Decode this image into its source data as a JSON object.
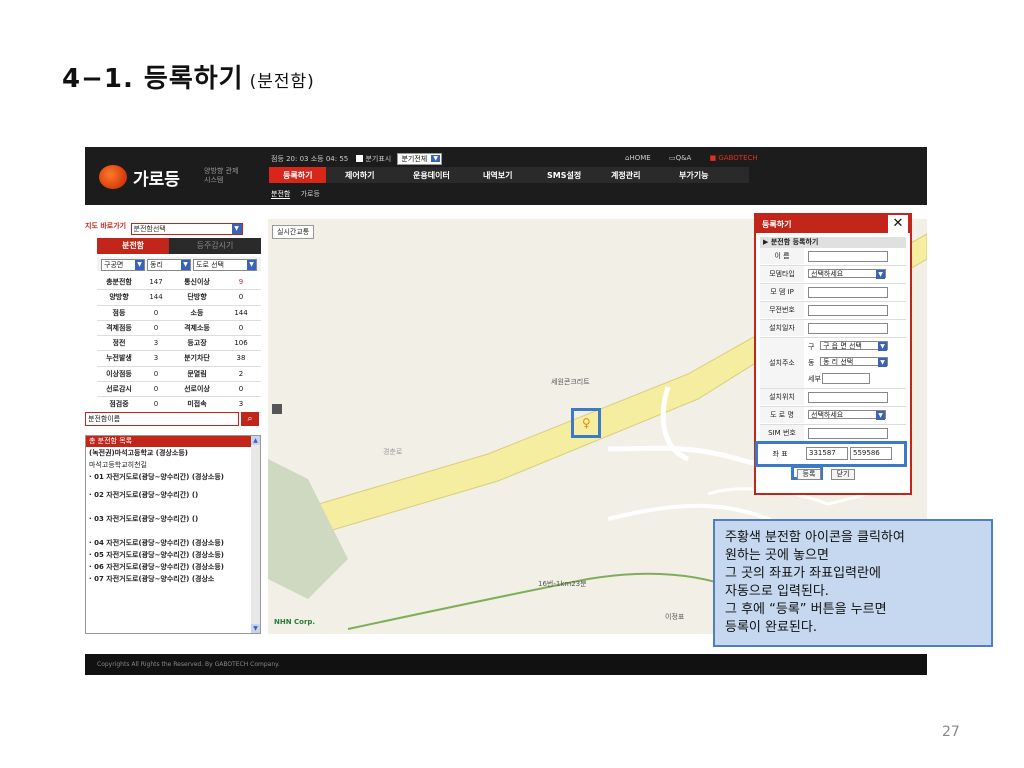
{
  "slide": {
    "title": "4−1. 등록하기",
    "subtitle": "(분전함)",
    "page_number": "27"
  },
  "header": {
    "logo_name": "가로등",
    "logo_tagline": "양방향 관제시스템",
    "stats": "점등 20: 03 소등 04: 55",
    "chk_label": "분기표시",
    "branch_select": "분기전체",
    "top_links": [
      "HOME",
      "Q&A",
      "GABOTECH"
    ],
    "menu": [
      "등록하기",
      "제어하기",
      "운용데이터",
      "내역보기",
      "SMS설정",
      "계정관리",
      "부가기능"
    ],
    "submenu": [
      "분전함",
      "가로등"
    ]
  },
  "left": {
    "jump_label": "지도 바로가기",
    "jump_select": "분전함선택",
    "tabs": [
      "분전함",
      "등주감시기"
    ],
    "filters": [
      "구공면",
      "동리",
      "도로 선택"
    ],
    "stats_rows": [
      {
        "l": "총분전함",
        "v": "147",
        "l2": "통신이상",
        "v2": "9"
      },
      {
        "l": "양방향",
        "v": "144",
        "l2": "단방향",
        "v2": "0"
      },
      {
        "l": "점등",
        "v": "0",
        "l2": "소등",
        "v2": "144"
      },
      {
        "l": "격제점등",
        "v": "0",
        "l2": "격제소등",
        "v2": "0"
      },
      {
        "l": "정전",
        "v": "3",
        "l2": "등고장",
        "v2": "106"
      },
      {
        "l": "누전발생",
        "v": "3",
        "l2": "분기차단",
        "v2": "38"
      },
      {
        "l": "이상점등",
        "v": "0",
        "l2": "문열림",
        "v2": "2"
      },
      {
        "l": "선로감시",
        "v": "0",
        "l2": "선로이상",
        "v2": "0"
      },
      {
        "l": "점검중",
        "v": "0",
        "l2": "미접속",
        "v2": "3"
      }
    ],
    "search_select": "분전함이름",
    "list_title": "총 분전함 목록",
    "list": [
      {
        "t": "(녹전권)마석고등학교 (경상소등)",
        "b": true
      },
      {
        "t": "마석고등학교히천길",
        "b": false
      },
      {
        "t": "· 01 자전거도로(광당~양수리간) (경상소등)",
        "b": true
      },
      {
        "t": "· 02 자전거도로(광당~양수리간) ()",
        "b": true
      },
      {
        "t": "· 03 자전거도로(광당~양수리간) ()",
        "b": true
      },
      {
        "t": "· 04 자전거도로(광당~양수리간) (경상소등)",
        "b": true
      },
      {
        "t": "· 05 자전거도로(광당~양수리간) (경상소등)",
        "b": true
      },
      {
        "t": "· 06 자전거도로(광당~양수리간) (경상소등)",
        "b": true
      },
      {
        "t": "· 07 자전거도로(광당~양수리간) (경상소",
        "b": true
      }
    ]
  },
  "map": {
    "button": "실시간교통",
    "labels": [
      "세원콘크리트",
      "경춘로",
      "이정표",
      "16번-1km23분"
    ],
    "credit": "NHN Corp."
  },
  "popup": {
    "title": "등록하기",
    "section": "분전함 등록하기",
    "fields": [
      {
        "label": "이  름",
        "type": "input",
        "value": ""
      },
      {
        "label": "모뎀타입",
        "type": "select",
        "value": "선택하세요"
      },
      {
        "label": "모 뎀 IP",
        "type": "input",
        "value": ""
      },
      {
        "label": "무전번호",
        "type": "input",
        "value": ""
      },
      {
        "label": "설치일자",
        "type": "input",
        "value": ""
      }
    ],
    "address_label": "설치주소",
    "address": [
      {
        "k": "구",
        "v": "구 읍 면 선택"
      },
      {
        "k": "동",
        "v": "동 리 선택"
      },
      {
        "k": "세부",
        "v": ""
      }
    ],
    "fields2": [
      {
        "label": "설치위치",
        "type": "input",
        "value": ""
      },
      {
        "label": "도 로 명",
        "type": "select",
        "value": "선택하세요"
      },
      {
        "label": "SIM 번호",
        "type": "input",
        "value": ""
      }
    ],
    "coord_label": "좌  표",
    "coord_x": "331587",
    "coord_y": "559586",
    "register_btn": "등록",
    "close_btn": "닫기"
  },
  "footer": "Copyrights All Rights the Reserved. By GABOTECH Company.",
  "callout": [
    "주황색 분전함 아이콘을 클릭하여",
    "원하는 곳에  놓으면",
    "그 곳의 좌표가  좌표입력란에",
    "자동으로 입력된다.",
    "그 후에 “등록” 버튼을 누르면",
    "등록이 완료된다."
  ]
}
